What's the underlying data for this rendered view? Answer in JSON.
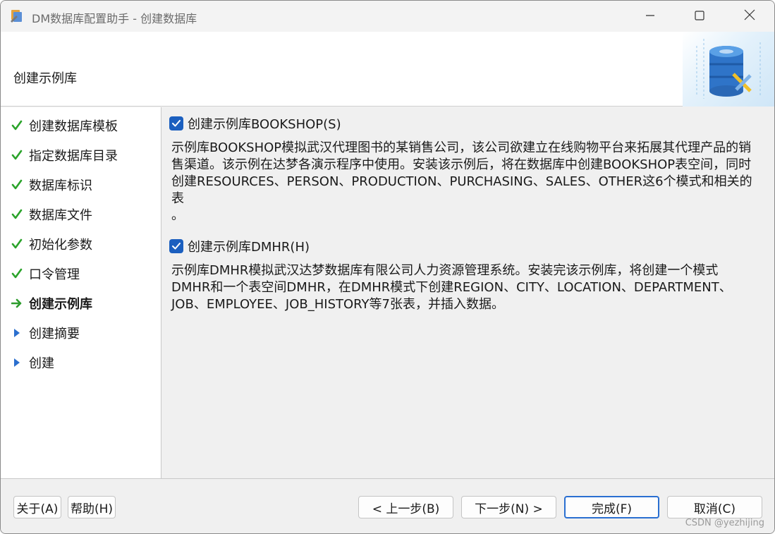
{
  "window": {
    "title": "DM数据库配置助手 - 创建数据库"
  },
  "header": {
    "title": "创建示例库"
  },
  "sidebar": {
    "steps": [
      {
        "label": "创建数据库模板",
        "state": "done"
      },
      {
        "label": "指定数据库目录",
        "state": "done"
      },
      {
        "label": "数据库标识",
        "state": "done"
      },
      {
        "label": "数据库文件",
        "state": "done"
      },
      {
        "label": "初始化参数",
        "state": "done"
      },
      {
        "label": "口令管理",
        "state": "done"
      },
      {
        "label": "创建示例库",
        "state": "current"
      },
      {
        "label": "创建摘要",
        "state": "pending"
      },
      {
        "label": "创建",
        "state": "pending"
      }
    ]
  },
  "main": {
    "bookshop": {
      "checkbox_label": "创建示例库BOOKSHOP(S)",
      "checked": true,
      "description": "示例库BOOKSHOP模拟武汉代理图书的某销售公司，该公司欲建立在线购物平台来拓展其代理产品的销\n售渠道。该示例在达梦各演示程序中使用。安装该示例后，将在数据库中创建BOOKSHOP表空间，同时\n创建RESOURCES、PERSON、PRODUCTION、PURCHASING、SALES、OTHER这6个模式和相关的表\n。"
    },
    "dmhr": {
      "checkbox_label": "创建示例库DMHR(H)",
      "checked": true,
      "description": "示例库DMHR模拟武汉达梦数据库有限公司人力资源管理系统。安装完该示例库，将创建一个模式\nDMHR和一个表空间DMHR，在DMHR模式下创建REGION、CITY、LOCATION、DEPARTMENT、\nJOB、EMPLOYEE、JOB_HISTORY等7张表，并插入数据。"
    }
  },
  "footer": {
    "about_label": "关于(A)",
    "help_label": "帮助(H)",
    "prev_label": "< 上一步(B)",
    "next_label": "下一步(N) >",
    "finish_label": "完成(F)",
    "cancel_label": "取消(C)"
  },
  "watermark": "CSDN @yezhijing",
  "colors": {
    "check_green": "#2aa32a",
    "arrow_green": "#2e9d2e",
    "pending_blue": "#2b6fce",
    "checkbox_blue": "#1b5fbf",
    "primary_border": "#2a6fd1"
  },
  "icons": {
    "done": "checkmark-icon",
    "current": "arrow-right-icon",
    "pending": "triangle-right-icon"
  }
}
